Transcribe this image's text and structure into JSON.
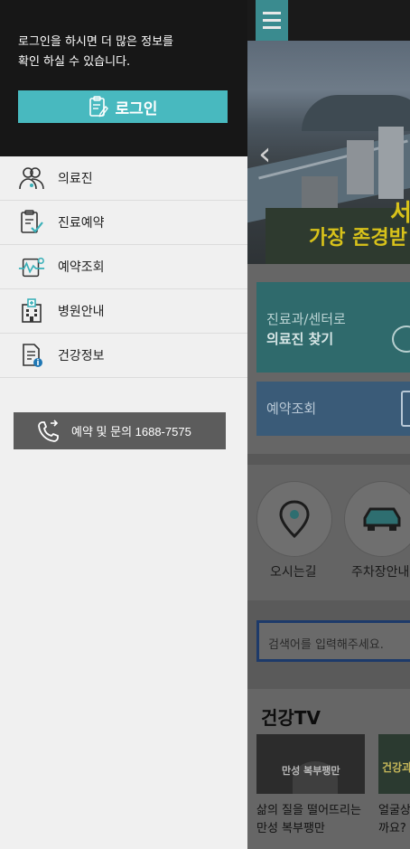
{
  "drawer": {
    "login_message": "로그인을 하시면 더 많은 정보를\n확인 하실 수 있습니다.",
    "login_button": "로그인",
    "menu_items": [
      {
        "label": "의료진",
        "icon": "doctors-icon"
      },
      {
        "label": "진료예약",
        "icon": "reservation-icon"
      },
      {
        "label": "예약조회",
        "icon": "reservation-check-icon"
      },
      {
        "label": "병원안내",
        "icon": "hospital-icon"
      },
      {
        "label": "건강정보",
        "icon": "health-info-icon"
      }
    ],
    "call_button": "예약 및 문의 1688-7575"
  },
  "background": {
    "hero_text_1": "서",
    "hero_text_2": "가장 존경받",
    "card_find_doctor_line1": "진료과/센터로",
    "card_find_doctor_line2": "의료진 찾기",
    "card_reservation": "예약조회",
    "quick_links": [
      "오시는길",
      "주차장안내"
    ],
    "search_placeholder": "검색어를 입력해주세요.",
    "tv_title": "건강TV",
    "tv_items": [
      {
        "thumb_caption": "만성 복부팽만",
        "thumb_small": "삶의 질을 떨어뜨리는",
        "caption": "삶의 질을 떨어뜨리는 만성 복부팽만"
      },
      {
        "thumb_caption": "건강과 얼굴",
        "caption": "얼굴상\n까요?"
      }
    ]
  },
  "colors": {
    "accent": "#48b9bf",
    "drawer_top": "#171717",
    "drawer_bg": "#f0f0f0",
    "call_button": "#5c5c5c",
    "hero_text": "#d8c21a"
  }
}
